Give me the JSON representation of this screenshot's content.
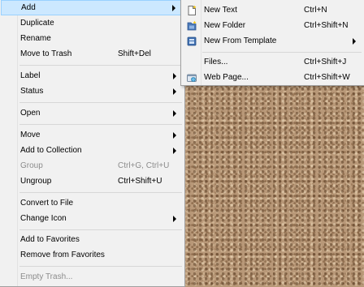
{
  "main_menu": {
    "add": "Add",
    "duplicate": "Duplicate",
    "rename": "Rename",
    "move_to_trash": "Move to Trash",
    "move_to_trash_shortcut": "Shift+Del",
    "label": "Label",
    "status": "Status",
    "open": "Open",
    "move": "Move",
    "add_to_collection": "Add to Collection",
    "group": "Group",
    "group_shortcut": "Ctrl+G, Ctrl+U",
    "ungroup": "Ungroup",
    "ungroup_shortcut": "Ctrl+Shift+U",
    "convert_to_file": "Convert to File",
    "change_icon": "Change Icon",
    "add_to_favorites": "Add to Favorites",
    "remove_from_favorites": "Remove from Favorites",
    "empty_trash": "Empty Trash..."
  },
  "submenu": {
    "new_text": "New Text",
    "new_text_shortcut": "Ctrl+N",
    "new_folder": "New Folder",
    "new_folder_shortcut": "Ctrl+Shift+N",
    "new_from_template": "New From Template",
    "files": "Files...",
    "files_shortcut": "Ctrl+Shift+J",
    "web_page": "Web Page...",
    "web_page_shortcut": "Ctrl+Shift+W"
  },
  "icons": {
    "new_text": "new-document-icon",
    "new_folder": "new-folder-icon",
    "template": "template-icon",
    "web_page": "web-page-icon"
  },
  "colors": {
    "highlight": "#cce8ff",
    "highlight_border": "#99d1ff",
    "menu_bg": "#f1f1f1",
    "disabled_text": "#8c8c8c"
  }
}
